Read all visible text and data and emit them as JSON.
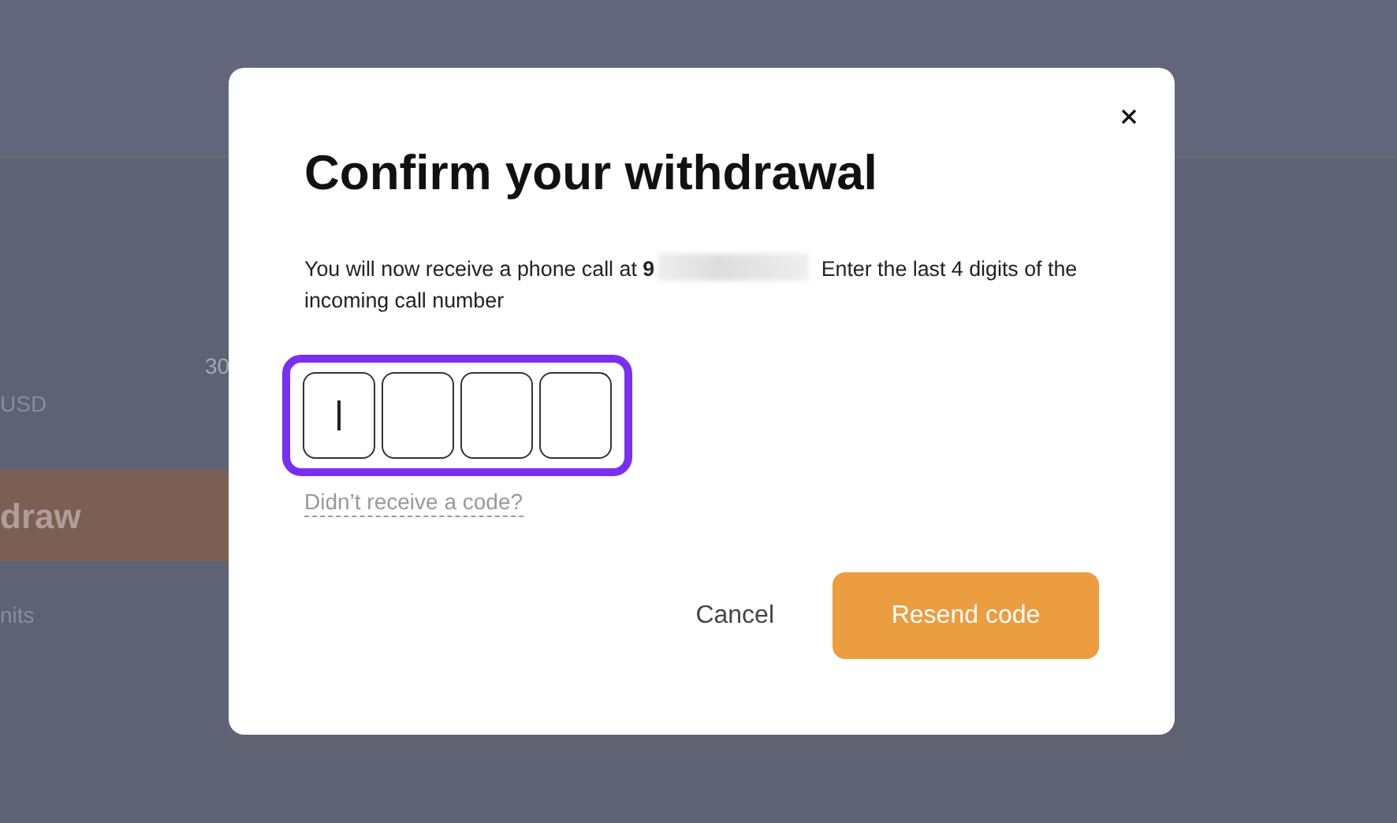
{
  "background_page": {
    "amount_fragment": "30",
    "currency_fragment": "USD",
    "button_fragment": "draw",
    "link_fragment": "nits"
  },
  "dialog": {
    "title": "Confirm your withdrawal",
    "message_before": "You will now receive a phone call at **9**",
    "message_after": "Enter the last 4 digits of the incoming call number",
    "code_digits": [
      {
        "focused": true
      },
      {
        "focused": false
      },
      {
        "focused": false
      },
      {
        "focused": false
      }
    ],
    "resend_link": "Didn’t receive a code?",
    "buttons": [
      {
        "kind": "secondary",
        "label": "Cancel"
      },
      {
        "kind": "primary",
        "label": "Resend code"
      }
    ]
  }
}
